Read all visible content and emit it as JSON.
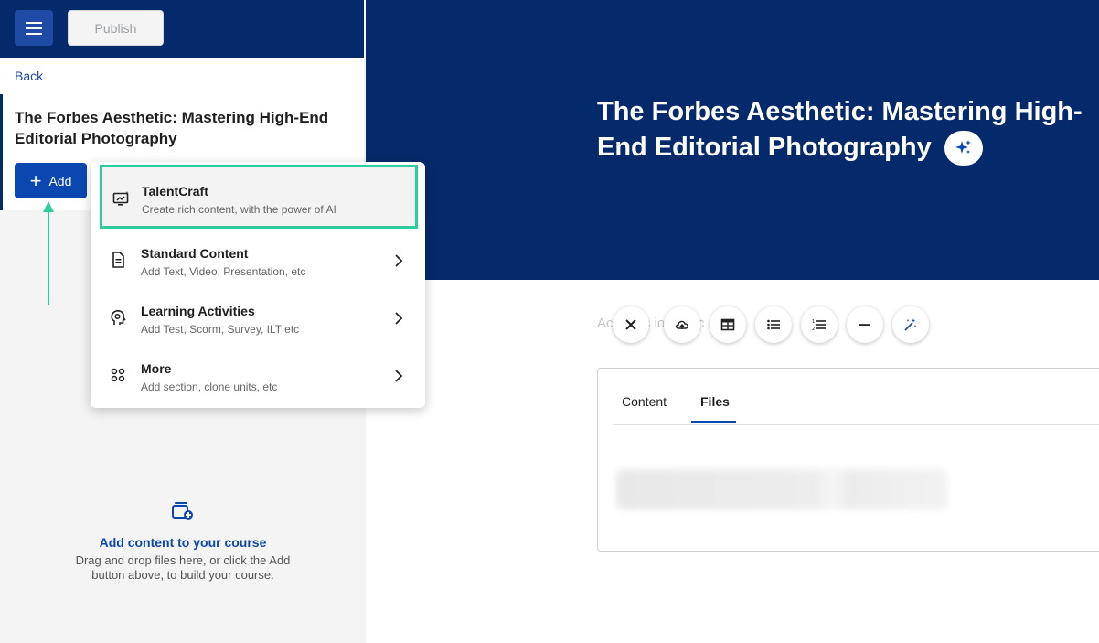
{
  "header": {
    "publish_label": "Publish"
  },
  "sidebar": {
    "back_label": "Back",
    "course_title": "The Forbes Aesthetic: Mastering High-End Editorial Photography",
    "add_label": "Add",
    "empty_state": {
      "title": "Add content to your course",
      "description": "Drag and drop files here, or click the Add button above, to build your course."
    }
  },
  "add_menu": {
    "items": [
      {
        "title": "TalentCraft",
        "subtitle": "Create rich content, with the power of AI",
        "icon": "ai-monitor-icon",
        "has_submenu": false,
        "highlighted": true
      },
      {
        "title": "Standard Content",
        "subtitle": "Add Text, Video, Presentation, etc",
        "icon": "document-icon",
        "has_submenu": true
      },
      {
        "title": "Learning Activities",
        "subtitle": "Add Test, Scorm, Survey, ILT etc",
        "icon": "brain-gear-icon",
        "has_submenu": true
      },
      {
        "title": "More",
        "subtitle": "Add section, clone units, etc",
        "icon": "grid-dots-icon",
        "has_submenu": true
      }
    ]
  },
  "main": {
    "hero_title": "The Forbes Aesthetic: Mastering High-End Editorial Photography",
    "description_placeholder": "Ac  ou   es   io   to   D    c",
    "toolbar": [
      "close-icon",
      "cloud-upload-icon",
      "table-icon",
      "bullet-list-icon",
      "numbered-list-icon",
      "horizontal-rule-icon",
      "magic-wand-icon"
    ],
    "tabs": [
      {
        "label": "Content",
        "active": false
      },
      {
        "label": "Files",
        "active": true
      }
    ]
  },
  "colors": {
    "navy": "#052a6b",
    "primary": "#0a47b0",
    "highlight": "#2ecc9f"
  }
}
